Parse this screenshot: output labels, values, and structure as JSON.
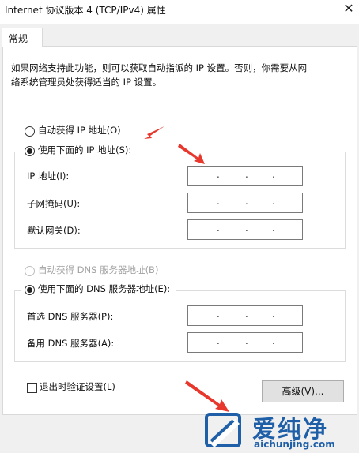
{
  "window": {
    "title": "Internet 协议版本 4 (TCP/IPv4) 属性",
    "close_glyph": "✕"
  },
  "tab": {
    "label": "常规"
  },
  "description": {
    "line1": "如果网络支持此功能，则可以获取自动指派的 IP 设置。否则，你需要从网",
    "line2": "络系统管理员处获得适当的 IP 设置。"
  },
  "ip": {
    "auto_label": "自动获得 IP 地址(O)",
    "auto_selected": false,
    "manual_label": "使用下面的 IP 地址(S):",
    "manual_selected": true,
    "fields": [
      {
        "label": "IP 地址(I):",
        "dots": ".  .  ."
      },
      {
        "label": "子网掩码(U):",
        "dots": ".  .  ."
      },
      {
        "label": "默认网关(D):",
        "dots": ".  .  ."
      }
    ]
  },
  "dns": {
    "auto_label": "自动获得 DNS 服务器地址(B)",
    "auto_selected": false,
    "auto_disabled": true,
    "manual_label": "使用下面的 DNS 服务器地址(E):",
    "manual_selected": true,
    "fields": [
      {
        "label": "首选 DNS 服务器(P):"
      },
      {
        "label": "备用 DNS 服务器(A):"
      }
    ]
  },
  "validate": {
    "label": "退出时验证设置(L)",
    "checked": false
  },
  "advanced_button": {
    "label": "高级(V)..."
  },
  "watermark": {
    "brand": "爱纯净",
    "url": "aichunjing.com"
  },
  "colors": {
    "arrow": "#e8372c",
    "watermark": "#1f5fa8"
  }
}
